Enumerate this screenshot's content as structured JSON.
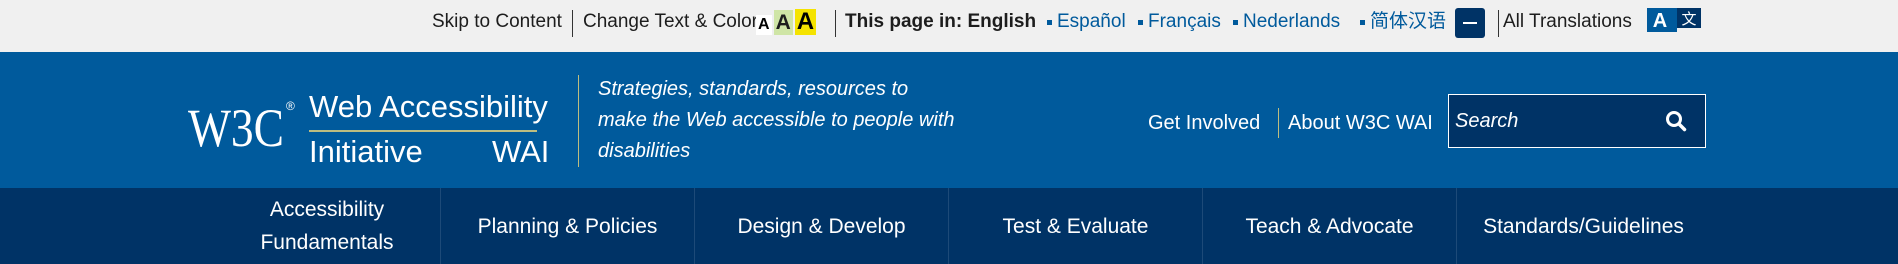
{
  "utility": {
    "skip_link": "Skip to Content",
    "change_text": "Change Text & Color",
    "text_size_small": "A",
    "text_size_medium": "A",
    "text_size_large": "A",
    "lang_lead": "This page in:",
    "current_lang": "English",
    "languages": [
      "Español",
      "Français",
      "Nederlands",
      "简体汉语"
    ],
    "all_translations": "All Translations",
    "translate_icon_glyphs": [
      "A",
      "文"
    ]
  },
  "header": {
    "logo_w3c": "W3C",
    "logo_title_line1": "Web Accessibility",
    "logo_title_line2": "Initiative",
    "logo_abbr": "WAI",
    "tagline": "Strategies, standards, resources to make the Web accessible to people with disabilities",
    "links": [
      "Get Involved",
      "About W3C WAI"
    ],
    "search_placeholder": "Search"
  },
  "main_nav": {
    "items": [
      "Accessibility Fundamentals",
      "Planning & Policies",
      "Design & Develop",
      "Test & Evaluate",
      "Teach & Advocate",
      "Standards/Guidelines"
    ]
  },
  "colors": {
    "header_blue": "#005a9c",
    "nav_dark_blue": "#003366",
    "utility_bg": "#f0f0f0",
    "accent_gold": "#bdbd80"
  },
  "icons": {
    "collapse": "minus-icon",
    "translations": "translate-icon",
    "search": "search-icon"
  }
}
